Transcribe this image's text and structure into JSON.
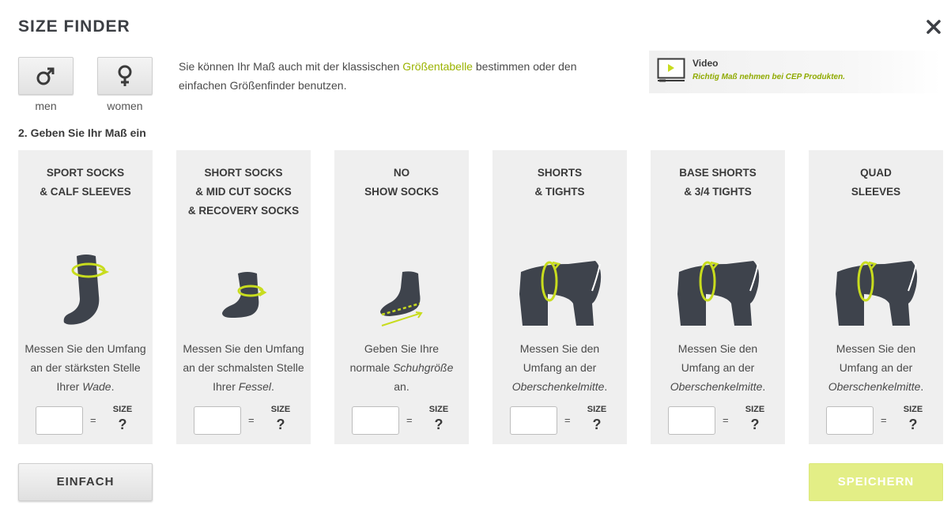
{
  "header": {
    "title": "SIZE FINDER",
    "close_icon": "close-icon"
  },
  "gender": [
    {
      "label": "men",
      "icon": "male-symbol-icon"
    },
    {
      "label": "women",
      "icon": "female-symbol-icon"
    }
  ],
  "intro": {
    "text_before": "Sie können Ihr Maß auch mit der klassischen ",
    "link": "Größentabelle",
    "text_after": " bestimmen oder den einfachen Größenfinder benutzen."
  },
  "video": {
    "title": "Video",
    "subtitle": "Richtig Maß nehmen bei CEP Produkten.",
    "icon": "video-play-icon"
  },
  "step_label": "2. Geben Sie Ihr Maß ein",
  "cards": [
    {
      "title1": "SPORT SOCKS",
      "title2": "& CALF SLEEVES",
      "title3": "",
      "desc1": "Messen Sie den Umfang",
      "desc2": "an der stärksten Stelle",
      "desc3": "Ihrer ",
      "desc_em": "Wade",
      "desc_end": ".",
      "equals": "=",
      "size_label": "SIZE",
      "size_value": "?",
      "icon": "calf-sock-icon"
    },
    {
      "title1": "SHORT SOCKS",
      "title2": "& MID CUT SOCKS",
      "title3": "& RECOVERY SOCKS",
      "desc1": "Messen Sie den Umfang",
      "desc2": "an der schmalsten Stelle",
      "desc3": "Ihrer ",
      "desc_em": "Fessel",
      "desc_end": ".",
      "equals": "=",
      "size_label": "SIZE",
      "size_value": "?",
      "icon": "ankle-sock-icon"
    },
    {
      "title1": "NO",
      "title2": "SHOW SOCKS",
      "title3": "",
      "desc1": "Geben Sie Ihre",
      "desc2": "normale ",
      "desc2_em": "Schuhgröße",
      "desc3": "an.",
      "desc_em": "",
      "desc_end": "",
      "equals": "=",
      "size_label": "SIZE",
      "size_value": "?",
      "icon": "foot-length-icon"
    },
    {
      "title1": "SHORTS",
      "title2": "& TIGHTS",
      "title3": "",
      "desc1": "Messen Sie den",
      "desc2": "Umfang an der",
      "desc3": "",
      "desc_em": "Oberschenkelmitte",
      "desc_end": ".",
      "equals": "=",
      "size_label": "SIZE",
      "size_value": "?",
      "icon": "thigh-icon"
    },
    {
      "title1": "BASE SHORTS",
      "title2": "& 3/4 TIGHTS",
      "title3": "",
      "desc1": "Messen Sie den",
      "desc2": "Umfang an der",
      "desc3": "",
      "desc_em": "Oberschenkelmitte",
      "desc_end": ".",
      "equals": "=",
      "size_label": "SIZE",
      "size_value": "?",
      "icon": "thigh-icon"
    },
    {
      "title1": "QUAD",
      "title2": "SLEEVES",
      "title3": "",
      "desc1": "Messen Sie den",
      "desc2": "Umfang an der",
      "desc3": "",
      "desc_em": "Oberschenkelmitte",
      "desc_end": ".",
      "equals": "=",
      "size_label": "SIZE",
      "size_value": "?",
      "icon": "thigh-icon"
    }
  ],
  "buttons": {
    "simple": "EINFACH",
    "save": "SPEICHERN"
  },
  "colors": {
    "accent": "#9bb300",
    "save_bg": "#e3ee86",
    "card_bg": "#efefef",
    "icon_dark": "#3e434c",
    "icon_ring": "#c8dc1e"
  }
}
